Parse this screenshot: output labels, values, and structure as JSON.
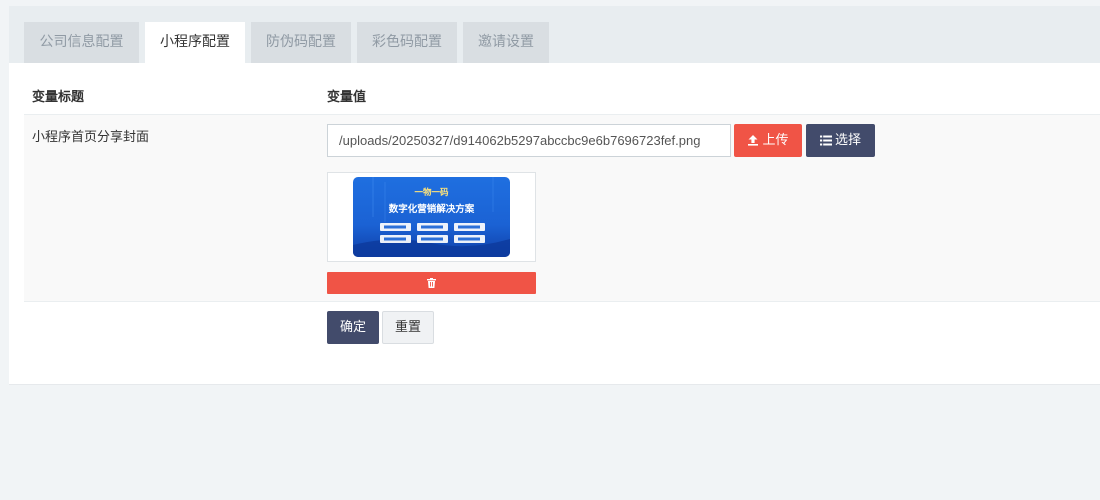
{
  "tabs": [
    {
      "label": "公司信息配置",
      "active": false
    },
    {
      "label": "小程序配置",
      "active": true
    },
    {
      "label": "防伪码配置",
      "active": false
    },
    {
      "label": "彩色码配置",
      "active": false
    },
    {
      "label": "邀请设置",
      "active": false
    }
  ],
  "table": {
    "col_title": "变量标题",
    "col_value": "变量值"
  },
  "row": {
    "label": "小程序首页分享封面",
    "path_value": "/uploads/20250327/d914062b5297abccbc9e6b7696723fef.png",
    "upload_label": "上传",
    "choose_label": "选择",
    "thumbnail": {
      "line1": "一物一码",
      "line2": "数字化营销解决方案"
    }
  },
  "actions": {
    "confirm_label": "确定",
    "reset_label": "重置"
  },
  "colors": {
    "danger": "#f05446",
    "primary": "#424b6b",
    "thumb_blue": "#1e74e6"
  },
  "icons": {
    "upload": "upload-icon",
    "choose": "list-icon",
    "delete": "trash-icon"
  }
}
